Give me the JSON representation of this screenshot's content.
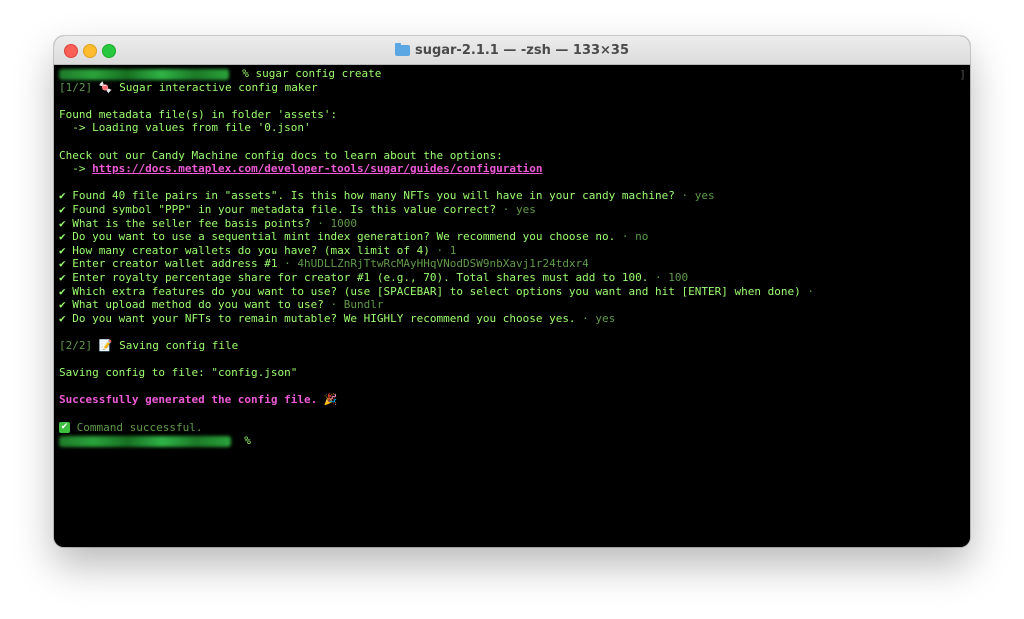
{
  "window": {
    "title": "sugar-2.1.1 — -zsh — 133×35"
  },
  "terminal": {
    "prompt_symbol": "%",
    "command": "sugar config create",
    "step1": "[1/2]",
    "step1_icon": "🍬",
    "step1_text": "Sugar interactive config maker",
    "found_metadata": "Found metadata file(s) in folder 'assets':",
    "loading_values": "  -> Loading values from file '0.json'",
    "check_docs": "Check out our Candy Machine config docs to learn about the options:",
    "docs_arrow": "  -> ",
    "docs_link": "https://docs.metaplex.com/developer-tools/sugar/guides/configuration",
    "answers": [
      {
        "q": "✔ Found 40 file pairs in \"assets\". Is this how many NFTs you will have in your candy machine?",
        "a": " · yes"
      },
      {
        "q": "✔ Found symbol \"PPP\" in your metadata file. Is this value correct?",
        "a": " · yes"
      },
      {
        "q": "✔ What is the seller fee basis points?",
        "a": " · 1000"
      },
      {
        "q": "✔ Do you want to use a sequential mint index generation? We recommend you choose no.",
        "a": " · no"
      },
      {
        "q": "✔ How many creator wallets do you have? (max limit of 4)",
        "a": " · 1"
      },
      {
        "q": "✔ Enter creator wallet address #1",
        "a": " · 4hUDLLZnRjTtwRcMAyHHqVNodDSW9nbXavj1r24tdxr4"
      },
      {
        "q": "✔ Enter royalty percentage share for creator #1 (e.g., 70). Total shares must add to 100.",
        "a": " · 100"
      },
      {
        "q": "✔ Which extra features do you want to use? (use [SPACEBAR] to select options you want and hit [ENTER] when done)",
        "a": " ·"
      },
      {
        "q": "✔ What upload method do you want to use?",
        "a": " · Bundlr"
      },
      {
        "q": "✔ Do you want your NFTs to remain mutable? We HIGHLY recommend you choose yes.",
        "a": " · yes"
      }
    ],
    "step2": "[2/2]",
    "step2_icon": "📝",
    "step2_text": "Saving config file",
    "saving": "Saving config to file: \"config.json\"",
    "success": "Successfully generated the config file.",
    "success_icon": "🎉",
    "command_success_icon": "✔",
    "command_success": "Command successful."
  }
}
